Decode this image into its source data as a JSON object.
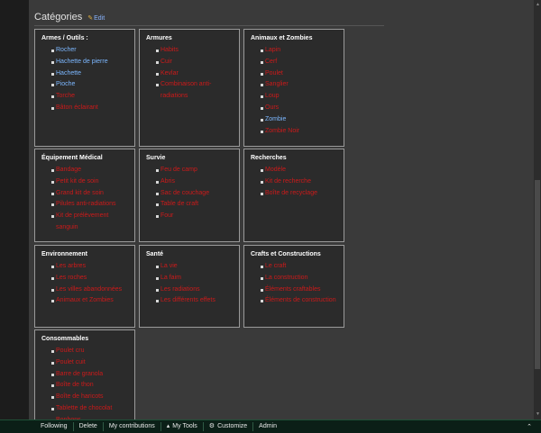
{
  "categories": {
    "title": "Catégories",
    "edit_label": "Edit"
  },
  "boxes": [
    {
      "title": "Armes / Outils :",
      "items": [
        {
          "label": "Rocher",
          "link": "blue"
        },
        {
          "label": "Hachette de pierre",
          "link": "blue"
        },
        {
          "label": "Hachette",
          "link": "blue"
        },
        {
          "label": "Pioche",
          "link": "blue"
        },
        {
          "label": "Torche",
          "link": "red"
        },
        {
          "label": "Bâton éclairant",
          "link": "red"
        }
      ]
    },
    {
      "title": "Armures",
      "items": [
        {
          "label": "Habits",
          "link": "red"
        },
        {
          "label": "Cuir",
          "link": "red"
        },
        {
          "label": "Kevlar",
          "link": "red"
        },
        {
          "label": "Combinaison anti-radiations",
          "link": "red"
        }
      ]
    },
    {
      "title": "Animaux et Zombies",
      "items": [
        {
          "label": "Lapin",
          "link": "red"
        },
        {
          "label": "Cerf",
          "link": "red"
        },
        {
          "label": "Poulet",
          "link": "red"
        },
        {
          "label": "Sanglier",
          "link": "red"
        },
        {
          "label": "Loup",
          "link": "red"
        },
        {
          "label": "Ours",
          "link": "red"
        },
        {
          "label": "Zombie",
          "link": "blue"
        },
        {
          "label": "Zombie Noir",
          "link": "red"
        }
      ]
    },
    {
      "title": "Équipement Médical",
      "items": [
        {
          "label": "Bandage",
          "link": "red"
        },
        {
          "label": "Petit kit de soin",
          "link": "red"
        },
        {
          "label": "Grand kit de soin",
          "link": "red"
        },
        {
          "label": "Pilules anti-radiations",
          "link": "red"
        },
        {
          "label": "Kit de prélèvement sanguin",
          "link": "red"
        }
      ]
    },
    {
      "title": "Survie",
      "items": [
        {
          "label": "Feu de camp",
          "link": "red"
        },
        {
          "label": "Abris",
          "link": "red"
        },
        {
          "label": "Sac de couchage",
          "link": "red"
        },
        {
          "label": "Table de craft",
          "link": "red"
        },
        {
          "label": "Four",
          "link": "red"
        }
      ]
    },
    {
      "title": "Recherches",
      "items": [
        {
          "label": "Modèle",
          "link": "red"
        },
        {
          "label": "Kit de recherche",
          "link": "red"
        },
        {
          "label": "Boîte de recyclage",
          "link": "red"
        }
      ]
    },
    {
      "title": "Environnement",
      "items": [
        {
          "label": "Les arbres",
          "link": "red"
        },
        {
          "label": "Les roches",
          "link": "red"
        },
        {
          "label": "Les villes abandonnées",
          "link": "red"
        },
        {
          "label": "Animaux et Zombies",
          "link": "red"
        }
      ]
    },
    {
      "title": "Santé",
      "items": [
        {
          "label": "La vie",
          "link": "red"
        },
        {
          "label": "La faim",
          "link": "red"
        },
        {
          "label": "Les radiations",
          "link": "red"
        },
        {
          "label": "Les différents effets",
          "link": "red"
        }
      ]
    },
    {
      "title": "Crafts et Constructions",
      "items": [
        {
          "label": "Le craft",
          "link": "red"
        },
        {
          "label": "La construction",
          "link": "red"
        },
        {
          "label": "Éléments craftables",
          "link": "red"
        },
        {
          "label": "Éléments de construction",
          "link": "red"
        }
      ]
    },
    {
      "title": "Consommables",
      "items": [
        {
          "label": "Poulet cru",
          "link": "red"
        },
        {
          "label": "Poulet cuit",
          "link": "red"
        },
        {
          "label": "Barre de granola",
          "link": "red"
        },
        {
          "label": "Boîte de thon",
          "link": "red"
        },
        {
          "label": "Boîte de haricots",
          "link": "red"
        },
        {
          "label": "Tablette de chocolat",
          "link": "red"
        },
        {
          "label": "Bonbons",
          "link": "red"
        }
      ]
    }
  ],
  "toolbar": {
    "following": "Following",
    "delete": "Delete",
    "contributions": "My contributions",
    "my_tools": "My Tools",
    "customize": "Customize",
    "admin": "Admin"
  },
  "colors": {
    "red_link": "#cc1a1a",
    "blue_link": "#7cb7ff",
    "toolbar_bg": "#0b1f17"
  }
}
